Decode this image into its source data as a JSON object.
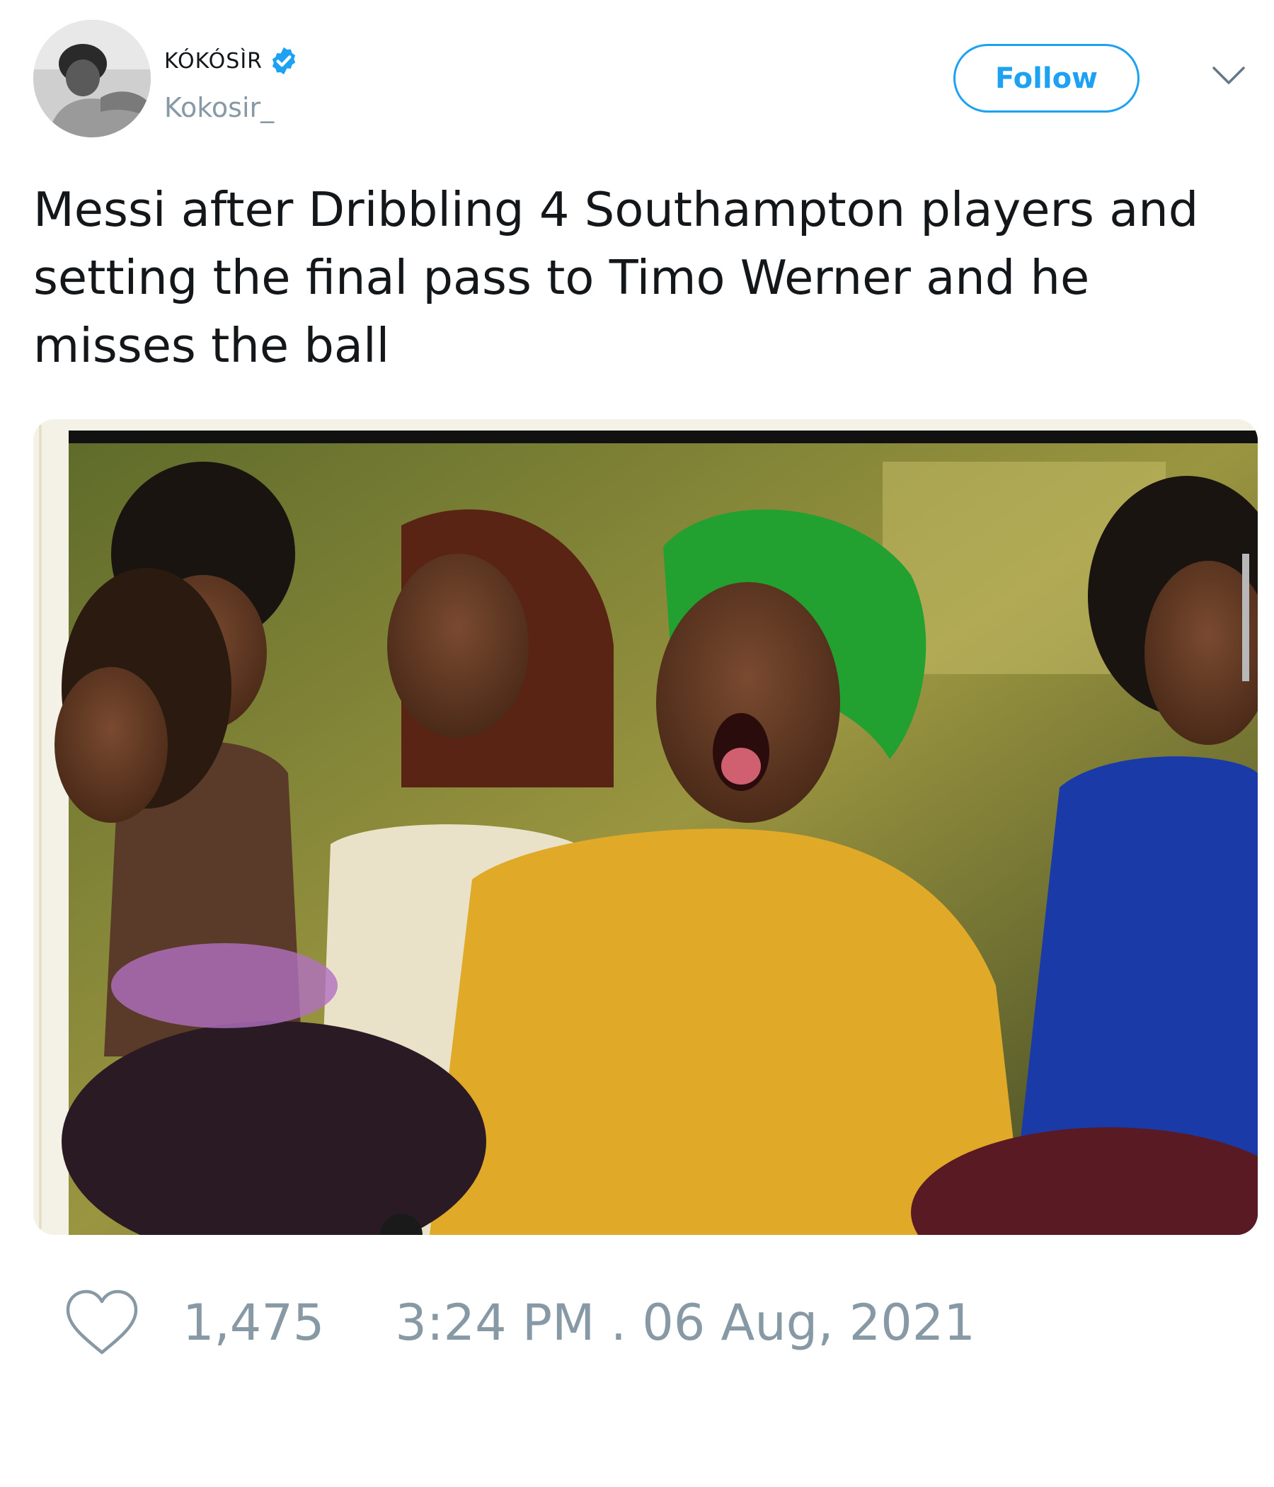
{
  "author": {
    "display_name": "KÓKÓSÌR",
    "handle": "Kokosir_",
    "verified": true
  },
  "actions": {
    "follow_label": "Follow"
  },
  "tweet": {
    "text": "Messi after Dribbling 4 Southampton players and\nsetting the final pass to Timo Werner and he\nmisses the ball",
    "likes": "1,475",
    "timestamp": "3:24 PM . 06 Aug, 2021"
  },
  "icons": {
    "verified": "verified-badge-icon",
    "caret": "chevron-down-icon",
    "like": "heart-icon"
  },
  "colors": {
    "accent": "#1da1f2",
    "muted": "#8899a6",
    "text": "#14171a"
  }
}
